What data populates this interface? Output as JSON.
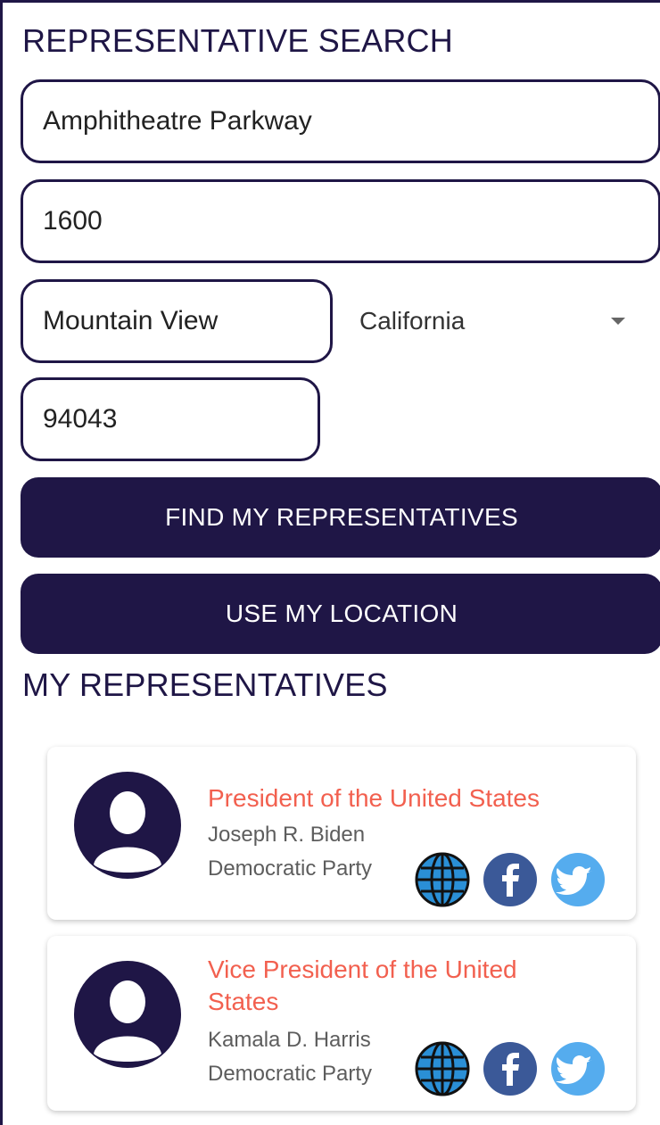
{
  "search": {
    "title": "REPRESENTATIVE SEARCH",
    "street_value": "Amphitheatre Parkway",
    "number_value": "1600",
    "city_value": "Mountain View",
    "state_value": "California",
    "zip_value": "94043"
  },
  "buttons": {
    "find_label": "FIND MY REPRESENTATIVES",
    "location_label": "USE MY LOCATION"
  },
  "reps": {
    "title": "MY REPRESENTATIVES",
    "items": [
      {
        "office": "President of the United States",
        "name": "Joseph R. Biden",
        "party": "Democratic Party"
      },
      {
        "office": "Vice President of the United States",
        "name": "Kamala D. Harris",
        "party": "Democratic Party"
      }
    ]
  },
  "icons": [
    "person-avatar",
    "globe-icon",
    "facebook-icon",
    "twitter-icon"
  ],
  "colors": {
    "navy": "#1f1646",
    "accent": "#f2604f",
    "facebook": "#3b5998",
    "twitter": "#55acee"
  }
}
